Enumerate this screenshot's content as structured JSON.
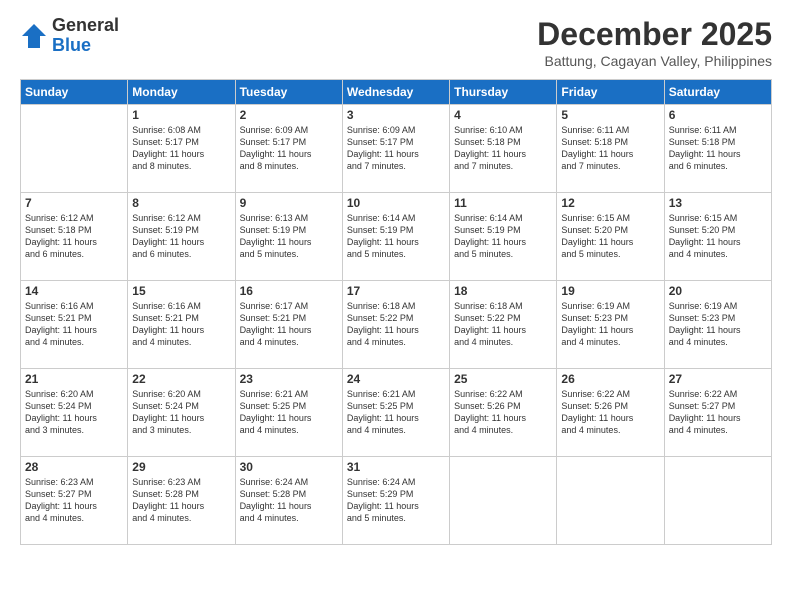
{
  "header": {
    "logo_general": "General",
    "logo_blue": "Blue",
    "month_title": "December 2025",
    "location": "Battung, Cagayan Valley, Philippines"
  },
  "days_of_week": [
    "Sunday",
    "Monday",
    "Tuesday",
    "Wednesday",
    "Thursday",
    "Friday",
    "Saturday"
  ],
  "weeks": [
    [
      {
        "day": "",
        "info": ""
      },
      {
        "day": "1",
        "info": "Sunrise: 6:08 AM\nSunset: 5:17 PM\nDaylight: 11 hours\nand 8 minutes."
      },
      {
        "day": "2",
        "info": "Sunrise: 6:09 AM\nSunset: 5:17 PM\nDaylight: 11 hours\nand 8 minutes."
      },
      {
        "day": "3",
        "info": "Sunrise: 6:09 AM\nSunset: 5:17 PM\nDaylight: 11 hours\nand 7 minutes."
      },
      {
        "day": "4",
        "info": "Sunrise: 6:10 AM\nSunset: 5:18 PM\nDaylight: 11 hours\nand 7 minutes."
      },
      {
        "day": "5",
        "info": "Sunrise: 6:11 AM\nSunset: 5:18 PM\nDaylight: 11 hours\nand 7 minutes."
      },
      {
        "day": "6",
        "info": "Sunrise: 6:11 AM\nSunset: 5:18 PM\nDaylight: 11 hours\nand 6 minutes."
      }
    ],
    [
      {
        "day": "7",
        "info": "Sunrise: 6:12 AM\nSunset: 5:18 PM\nDaylight: 11 hours\nand 6 minutes."
      },
      {
        "day": "8",
        "info": "Sunrise: 6:12 AM\nSunset: 5:19 PM\nDaylight: 11 hours\nand 6 minutes."
      },
      {
        "day": "9",
        "info": "Sunrise: 6:13 AM\nSunset: 5:19 PM\nDaylight: 11 hours\nand 5 minutes."
      },
      {
        "day": "10",
        "info": "Sunrise: 6:14 AM\nSunset: 5:19 PM\nDaylight: 11 hours\nand 5 minutes."
      },
      {
        "day": "11",
        "info": "Sunrise: 6:14 AM\nSunset: 5:19 PM\nDaylight: 11 hours\nand 5 minutes."
      },
      {
        "day": "12",
        "info": "Sunrise: 6:15 AM\nSunset: 5:20 PM\nDaylight: 11 hours\nand 5 minutes."
      },
      {
        "day": "13",
        "info": "Sunrise: 6:15 AM\nSunset: 5:20 PM\nDaylight: 11 hours\nand 4 minutes."
      }
    ],
    [
      {
        "day": "14",
        "info": "Sunrise: 6:16 AM\nSunset: 5:21 PM\nDaylight: 11 hours\nand 4 minutes."
      },
      {
        "day": "15",
        "info": "Sunrise: 6:16 AM\nSunset: 5:21 PM\nDaylight: 11 hours\nand 4 minutes."
      },
      {
        "day": "16",
        "info": "Sunrise: 6:17 AM\nSunset: 5:21 PM\nDaylight: 11 hours\nand 4 minutes."
      },
      {
        "day": "17",
        "info": "Sunrise: 6:18 AM\nSunset: 5:22 PM\nDaylight: 11 hours\nand 4 minutes."
      },
      {
        "day": "18",
        "info": "Sunrise: 6:18 AM\nSunset: 5:22 PM\nDaylight: 11 hours\nand 4 minutes."
      },
      {
        "day": "19",
        "info": "Sunrise: 6:19 AM\nSunset: 5:23 PM\nDaylight: 11 hours\nand 4 minutes."
      },
      {
        "day": "20",
        "info": "Sunrise: 6:19 AM\nSunset: 5:23 PM\nDaylight: 11 hours\nand 4 minutes."
      }
    ],
    [
      {
        "day": "21",
        "info": "Sunrise: 6:20 AM\nSunset: 5:24 PM\nDaylight: 11 hours\nand 3 minutes."
      },
      {
        "day": "22",
        "info": "Sunrise: 6:20 AM\nSunset: 5:24 PM\nDaylight: 11 hours\nand 3 minutes."
      },
      {
        "day": "23",
        "info": "Sunrise: 6:21 AM\nSunset: 5:25 PM\nDaylight: 11 hours\nand 4 minutes."
      },
      {
        "day": "24",
        "info": "Sunrise: 6:21 AM\nSunset: 5:25 PM\nDaylight: 11 hours\nand 4 minutes."
      },
      {
        "day": "25",
        "info": "Sunrise: 6:22 AM\nSunset: 5:26 PM\nDaylight: 11 hours\nand 4 minutes."
      },
      {
        "day": "26",
        "info": "Sunrise: 6:22 AM\nSunset: 5:26 PM\nDaylight: 11 hours\nand 4 minutes."
      },
      {
        "day": "27",
        "info": "Sunrise: 6:22 AM\nSunset: 5:27 PM\nDaylight: 11 hours\nand 4 minutes."
      }
    ],
    [
      {
        "day": "28",
        "info": "Sunrise: 6:23 AM\nSunset: 5:27 PM\nDaylight: 11 hours\nand 4 minutes."
      },
      {
        "day": "29",
        "info": "Sunrise: 6:23 AM\nSunset: 5:28 PM\nDaylight: 11 hours\nand 4 minutes."
      },
      {
        "day": "30",
        "info": "Sunrise: 6:24 AM\nSunset: 5:28 PM\nDaylight: 11 hours\nand 4 minutes."
      },
      {
        "day": "31",
        "info": "Sunrise: 6:24 AM\nSunset: 5:29 PM\nDaylight: 11 hours\nand 5 minutes."
      },
      {
        "day": "",
        "info": ""
      },
      {
        "day": "",
        "info": ""
      },
      {
        "day": "",
        "info": ""
      }
    ]
  ]
}
